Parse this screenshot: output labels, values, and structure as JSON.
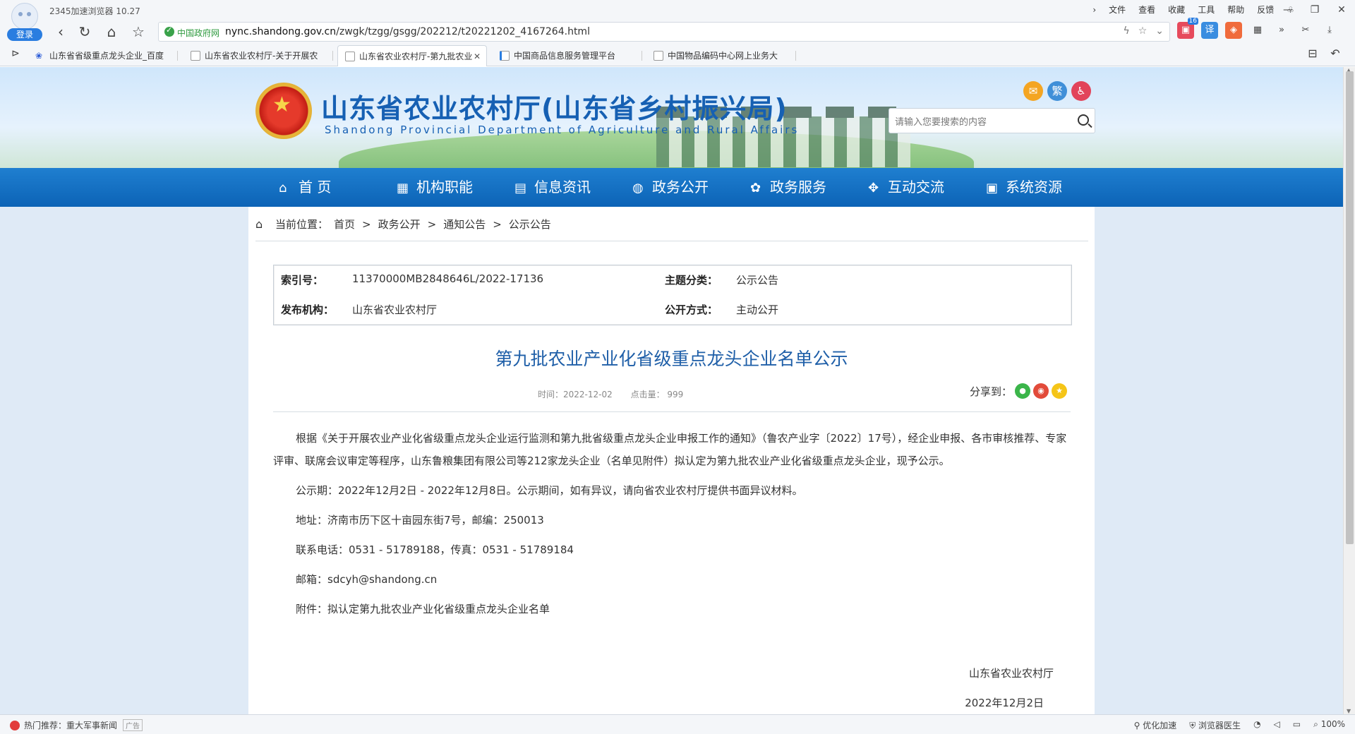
{
  "browser": {
    "app_name": "2345加速浏览器 10.27",
    "login": "登录",
    "menu": [
      "文件",
      "查看",
      "收藏",
      "工具",
      "帮助",
      "反馈"
    ],
    "address": {
      "gov_label": "中国政府网",
      "host": "nync.shandong.gov.cn",
      "path": "/zwgk/tzgg/gsgg/202212/t20221202_4167264.html"
    },
    "ext_badge": "16",
    "tabs": [
      {
        "title": "山东省省级重点龙头企业_百度"
      },
      {
        "title": "山东省农业农村厅-关于开展农"
      },
      {
        "title": "山东省农业农村厅-第九批农业",
        "active": true
      },
      {
        "title": "中国商品信息服务管理平台"
      },
      {
        "title": "中国物品编码中心网上业务大"
      }
    ],
    "status": {
      "hot_label": "热门推荐：重大军事新闻",
      "ad": "广告",
      "optimize": "优化加速",
      "doctor": "浏览器医生",
      "zoom": "100%"
    }
  },
  "site": {
    "title": "山东省农业农村厅(山东省乡村振兴局)",
    "subtitle": "Shandong Provincial Department of Agriculture and Rural Affairs",
    "quick": {
      "traditional": "繁"
    },
    "search_placeholder": "请输入您要搜索的内容",
    "nav": [
      {
        "label": "首 页",
        "icon": "⌂"
      },
      {
        "label": "机构职能",
        "icon": "▦"
      },
      {
        "label": "信息资讯",
        "icon": "▤"
      },
      {
        "label": "政务公开",
        "icon": "◍"
      },
      {
        "label": "政务服务",
        "icon": "✿"
      },
      {
        "label": "互动交流",
        "icon": "✥"
      },
      {
        "label": "系统资源",
        "icon": "▣"
      }
    ]
  },
  "breadcrumb": {
    "label": "当前位置：",
    "items": [
      "首页",
      "政务公开",
      "通知公告",
      "公示公告"
    ],
    "sep": ">"
  },
  "meta": {
    "index_label": "索引号：",
    "index_value": "11370000MB2848646L/2022-17136",
    "topic_label": "主题分类：",
    "topic_value": "公示公告",
    "publisher_label": "发布机构：",
    "publisher_value": "山东省农业农村厅",
    "mode_label": "公开方式：",
    "mode_value": "主动公开"
  },
  "article": {
    "title": "第九批农业产业化省级重点龙头企业名单公示",
    "time": "时间：2022-12-02",
    "hits": "点击量：   999",
    "share_label": "分享到：",
    "paragraphs": [
      "根据《关于开展农业产业化省级重点龙头企业运行监测和第九批省级重点龙头企业申报工作的通知》（鲁农产业字〔2022〕17号），经企业申报、各市审核推荐、专家评审、联席会议审定等程序，山东鲁粮集团有限公司等212家龙头企业（名单见附件）拟认定为第九批农业产业化省级重点龙头企业，现予公示。",
      "公示期：2022年12月2日 - 2022年12月8日。公示期间，如有异议，请向省农业农村厅提供书面异议材料。",
      "地址：济南市历下区十亩园东街7号，邮编：250013",
      "联系电话：0531 - 51789188，传真：0531 - 51789184",
      "邮箱：sdcyh@shandong.cn",
      "附件：拟认定第九批农业产业化省级重点龙头企业名单"
    ],
    "sign_org": "山东省农业农村厅",
    "sign_date": "2022年12月2日"
  },
  "colors": {
    "nav": "#0c63b6",
    "title": "#1660b3",
    "article_title": "#1f5fa8"
  }
}
